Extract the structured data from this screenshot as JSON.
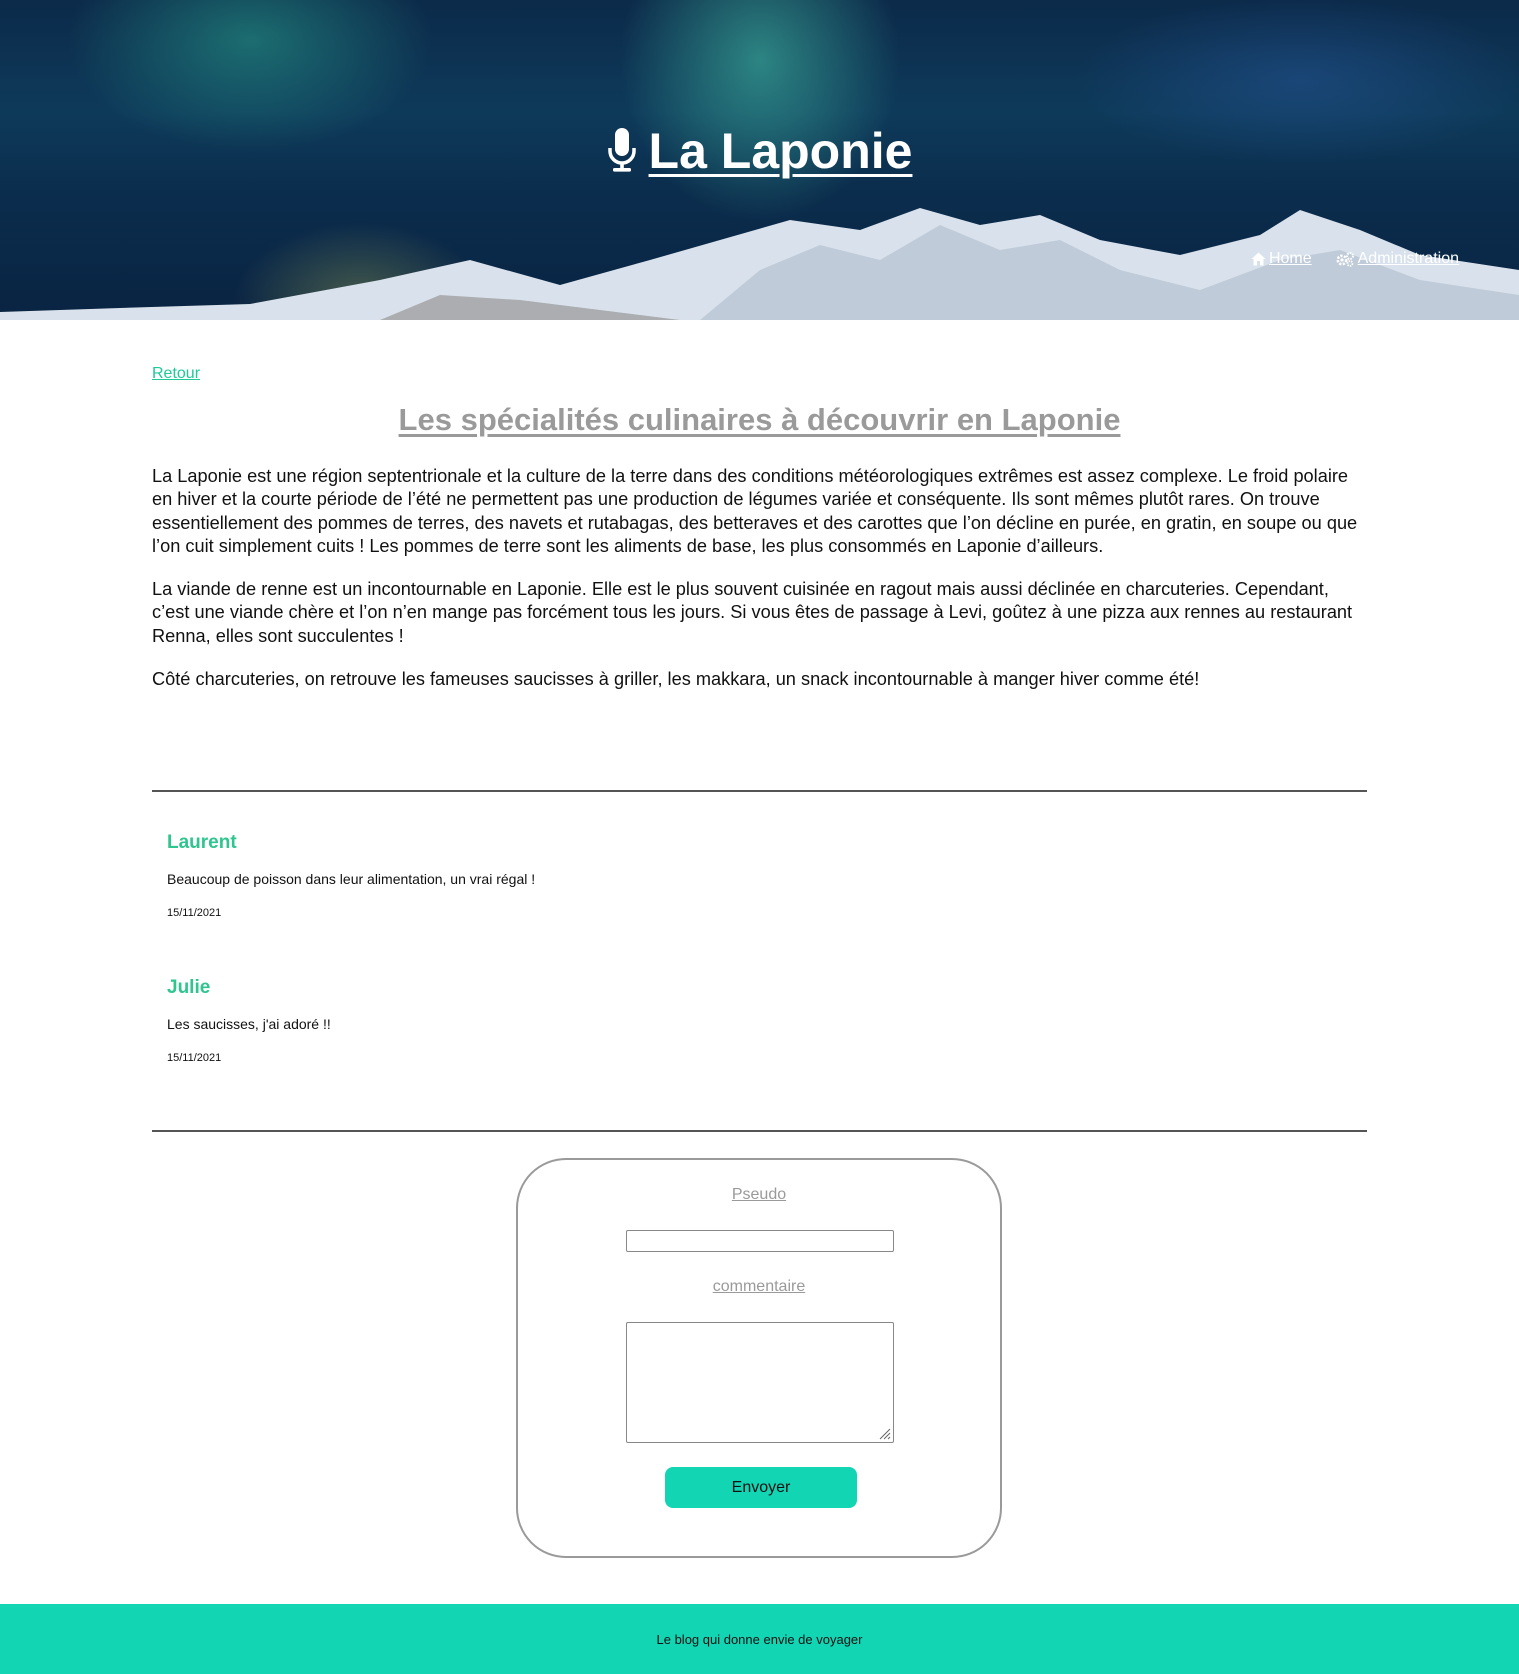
{
  "header": {
    "title": "La Laponie",
    "title_icon": "microphone-icon",
    "nav": [
      {
        "label": "Home",
        "icon": "home-icon"
      },
      {
        "label": "Administration",
        "icon": "gears-icon"
      }
    ]
  },
  "main": {
    "back_link": "Retour",
    "article": {
      "title": "Les spécialités culinaires à découvrir en Laponie",
      "paragraphs": [
        "La Laponie est une région septentrionale et la culture de la terre dans des conditions météorologiques extrêmes est assez complexe. Le froid polaire en hiver et la courte période de l’été ne permettent pas une production de légumes variée et conséquente. Ils sont mêmes plutôt rares. On trouve essentiellement des pommes de terres, des navets et rutabagas, des betteraves et des carottes que l’on décline en purée, en gratin, en soupe ou que l’on cuit simplement cuits ! Les pommes de terre sont les aliments de base, les plus consommés en Laponie d’ailleurs.",
        "La viande de renne est un incontournable en Laponie. Elle est le plus souvent cuisinée en ragout mais aussi déclinée en charcuteries. Cependant, c’est une viande chère et l’on n’en mange pas forcément tous les jours. Si vous êtes de passage à Levi, goûtez à une pizza aux rennes au restaurant Renna, elles sont succulentes !",
        "Côté charcuteries, on retrouve les fameuses saucisses à griller, les makkara, un snack incontournable à manger hiver comme été!"
      ]
    },
    "comments": [
      {
        "author": "Laurent",
        "text": "Beaucoup de poisson dans leur alimentation, un vrai régal !",
        "date": "15/11/2021"
      },
      {
        "author": "Julie",
        "text": "Les saucisses, j'ai adoré !!",
        "date": "15/11/2021"
      }
    ],
    "form": {
      "pseudo_label": "Pseudo",
      "pseudo_value": "",
      "comment_label": "commentaire",
      "comment_value": "",
      "submit_label": "Envoyer"
    }
  },
  "footer": {
    "text": "Le blog qui donne envie de voyager"
  },
  "colors": {
    "accent": "#12d5b4",
    "author": "#2fc58f",
    "link": "#1ec99a",
    "muted": "#9a9a9a"
  }
}
